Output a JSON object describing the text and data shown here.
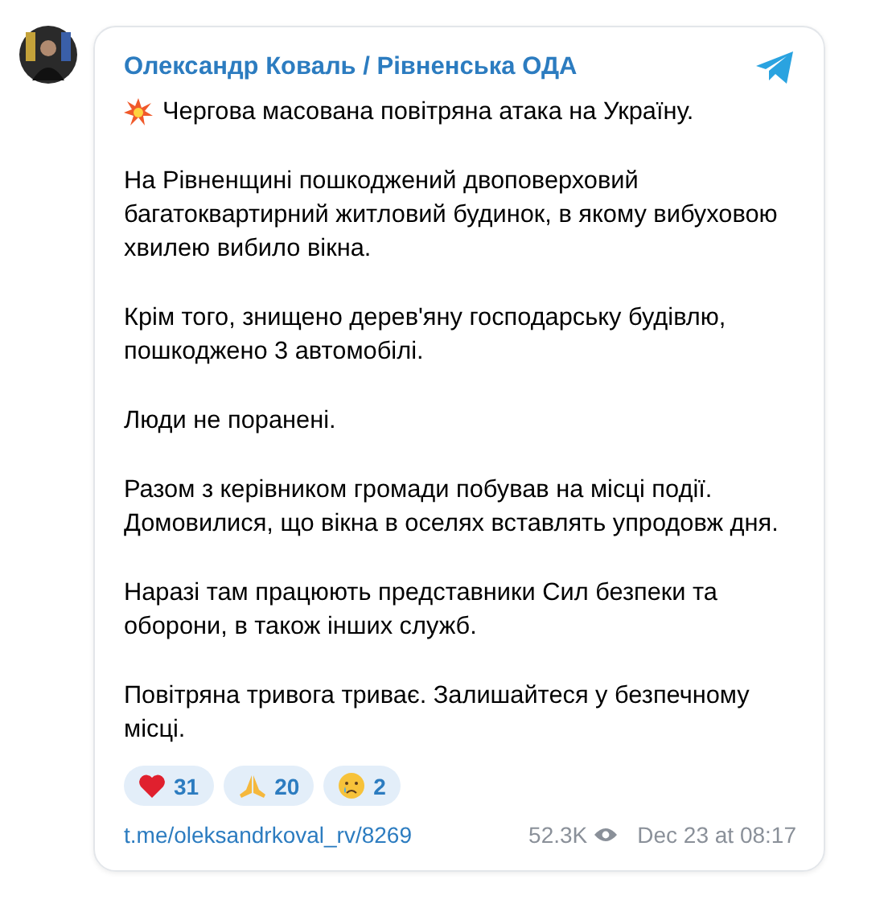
{
  "post": {
    "author": "Олександр Коваль / Рівненська ОДА",
    "paragraphs": [
      {
        "kind": "explosion",
        "text": "Чергова масована повітряна атака на Україну."
      },
      {
        "text": "На Рівненщині пошкоджений двоповерховий багатоквартирний житловий будинок, в якому вибуховою хвилею вибило вікна."
      },
      {
        "text": "Крім того, знищено дерев'яну господарську будівлю, пошкоджено 3 автомобілі."
      },
      {
        "text": "Люди не поранені."
      },
      {
        "text": "Разом з керівником громади побував на місці події. Домовилися, що вікна в оселях вставлять упродовж дня."
      },
      {
        "text": "Наразі там працюють представники Сил безпеки та оборони, в також інших служб."
      },
      {
        "text": "Повітряна тривога триває. Залишайтеся у безпечному місці."
      }
    ],
    "reactions": [
      {
        "kind": "heart",
        "count": "31"
      },
      {
        "kind": "pray",
        "count": "20"
      },
      {
        "kind": "tear",
        "count": "2"
      }
    ],
    "link": "t.me/oleksandrkoval_rv/8269",
    "views": "52.3K",
    "date": "Dec 23 at 08:17"
  }
}
